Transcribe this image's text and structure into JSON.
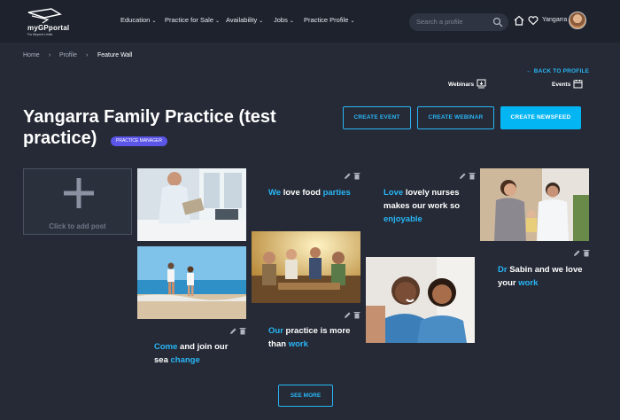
{
  "header": {
    "logo_title": "myGPportal",
    "logo_tagline": "For Beyond Limits",
    "nav": [
      "Education",
      "Practice for Sale",
      "Availability",
      "Jobs",
      "Practice Profile"
    ],
    "search_placeholder": "Search a profile",
    "user_name": "Yangarra"
  },
  "breadcrumb": [
    "Home",
    "Profile",
    "Feature Wall"
  ],
  "links": {
    "back": "← BACK TO PROFILE",
    "webinars": "Webinars",
    "events": "Events"
  },
  "page": {
    "title": "Yangarra Family Practice (test practice)",
    "badge": "PRACTICE MANAGER"
  },
  "buttons": {
    "create_event": "CREATE EVENT",
    "create_webinar": "CREATE WEBINAR",
    "create_newsfeed": "CREATE NEWSFEED",
    "see_more": "SEE MORE"
  },
  "wall": {
    "add_post": "Click to add post",
    "posts": [
      {
        "pre": "",
        "hl1": "We",
        "mid": " love food ",
        "hl2": "parties",
        "post": ""
      },
      {
        "pre": "",
        "hl1": "Love",
        "mid": " lovely nurses makes our work so ",
        "hl2": "enjoyable",
        "post": ""
      },
      {
        "pre": "",
        "hl1": "Dr",
        "mid": " Sabin and we love your ",
        "hl2": "work",
        "post": ""
      },
      {
        "pre": "",
        "hl1": "Come",
        "mid": " and join our sea ",
        "hl2": "change",
        "post": ""
      },
      {
        "pre": "",
        "hl1": "Our",
        "mid": " practice is more than ",
        "hl2": "work",
        "post": ""
      }
    ]
  },
  "colors": {
    "background": "#252a36",
    "header": "#1d222d",
    "accent": "#29b6f6",
    "badge": "#5b55e8"
  }
}
